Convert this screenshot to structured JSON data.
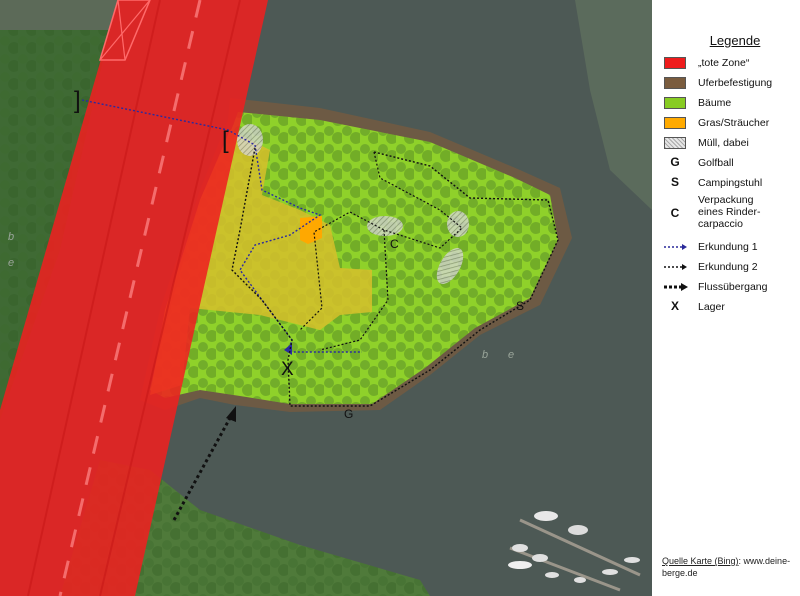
{
  "legend": {
    "title": "Legende",
    "items": [
      {
        "type": "swatch",
        "color": "#ee1c1c",
        "label": "„tote Zone“"
      },
      {
        "type": "swatch",
        "color": "#7a5c3e",
        "label": "Uferbefestigung"
      },
      {
        "type": "swatch",
        "color": "#88cc22",
        "label": "Bäume"
      },
      {
        "type": "swatch",
        "color": "#ffaa00",
        "label": "Gras/Sträucher"
      },
      {
        "type": "hatch",
        "color": "#cccccc",
        "label": "Müll, dabei"
      },
      {
        "type": "symbol",
        "symbol": "G",
        "label": "Golfball"
      },
      {
        "type": "symbol",
        "symbol": "S",
        "label": "Campingstuhl"
      },
      {
        "type": "symbol-tall",
        "symbol": "C",
        "label_lines": [
          "Verpackung",
          "eines Rinder-",
          "carpaccio"
        ]
      },
      {
        "type": "line-blue",
        "color": "#2a2a9a",
        "label": "Erkundung 1"
      },
      {
        "type": "line-black",
        "color": "#111111",
        "label": "Erkundung 2"
      },
      {
        "type": "line-thick",
        "color": "#111111",
        "label": "Flussübergang"
      },
      {
        "type": "symbol",
        "symbol": "X",
        "label": "Lager"
      }
    ]
  },
  "source": {
    "link_text": "Quelle Karte (Bing)",
    "rest_text": ": www.deine-berge.de"
  },
  "map": {
    "markers": {
      "c": "C",
      "s": "S",
      "g": "G",
      "x": "X"
    },
    "river_letters": [
      "b",
      "e",
      "b",
      "e"
    ]
  }
}
